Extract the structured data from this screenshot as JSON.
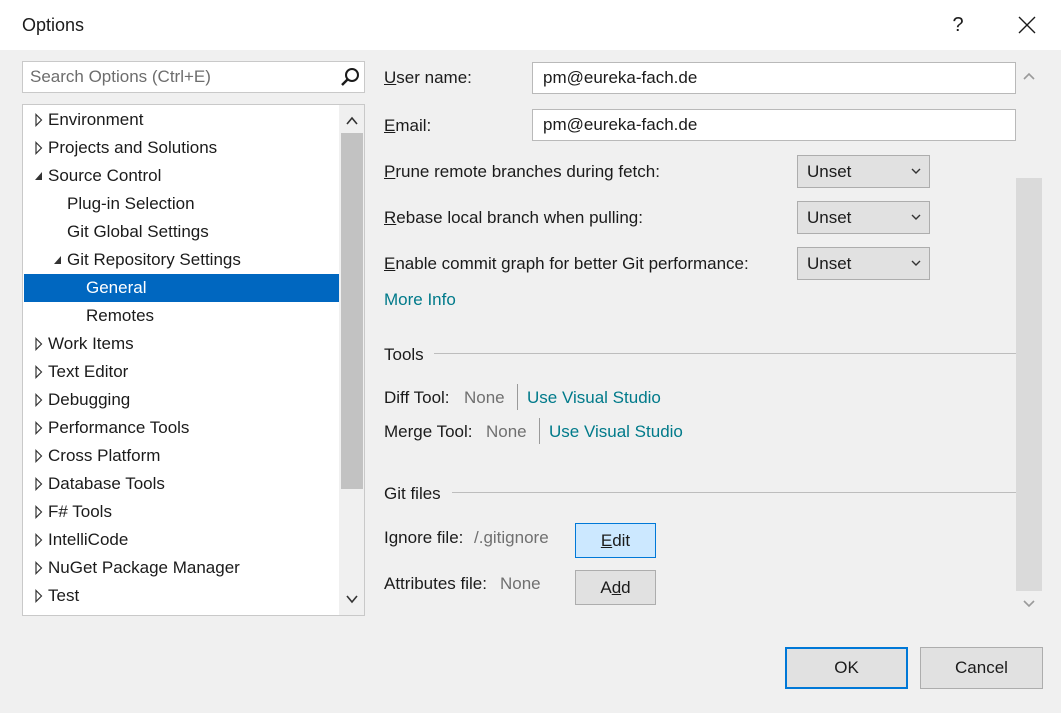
{
  "window": {
    "title": "Options",
    "help_label": "?"
  },
  "search": {
    "placeholder": "Search Options (Ctrl+E)"
  },
  "tree": {
    "items": [
      {
        "label": "Environment",
        "expander": "collapsed"
      },
      {
        "label": "Projects and Solutions",
        "expander": "collapsed"
      },
      {
        "label": "Source Control",
        "expander": "expanded"
      },
      {
        "label": "Plug-in Selection",
        "expander": "none"
      },
      {
        "label": "Git Global Settings",
        "expander": "none"
      },
      {
        "label": "Git Repository Settings",
        "expander": "expanded"
      },
      {
        "label": "General",
        "expander": "none",
        "selected": true
      },
      {
        "label": "Remotes",
        "expander": "none"
      },
      {
        "label": "Work Items",
        "expander": "collapsed"
      },
      {
        "label": "Text Editor",
        "expander": "collapsed"
      },
      {
        "label": "Debugging",
        "expander": "collapsed"
      },
      {
        "label": "Performance Tools",
        "expander": "collapsed"
      },
      {
        "label": "Cross Platform",
        "expander": "collapsed"
      },
      {
        "label": "Database Tools",
        "expander": "collapsed"
      },
      {
        "label": "F# Tools",
        "expander": "collapsed"
      },
      {
        "label": "IntelliCode",
        "expander": "collapsed"
      },
      {
        "label": "NuGet Package Manager",
        "expander": "collapsed"
      },
      {
        "label": "Test",
        "expander": "collapsed"
      }
    ]
  },
  "settings": {
    "user_name": {
      "access_key": "U",
      "rest": "ser name:",
      "value": "pm@eureka-fach.de"
    },
    "email": {
      "access_key": "E",
      "rest": "mail:",
      "value": "pm@eureka-fach.de"
    },
    "prune": {
      "access_key": "P",
      "rest": "rune remote branches during fetch:",
      "value": "Unset"
    },
    "rebase": {
      "access_key": "R",
      "rest": "ebase local branch when pulling:",
      "value": "Unset"
    },
    "commit_graph": {
      "access_key": "E",
      "rest": "nable commit graph for better Git performance:",
      "value": "Unset"
    },
    "more_info": "More Info"
  },
  "tools": {
    "heading": "Tools",
    "diff_label": "Diff Tool:",
    "diff_value": "None",
    "diff_link": "Use Visual Studio",
    "merge_label": "Merge Tool:",
    "merge_value": "None",
    "merge_link": "Use Visual Studio"
  },
  "git_files": {
    "heading": "Git files",
    "ignore_label": "Ignore file:",
    "ignore_value": "/.gitignore",
    "edit_key": "E",
    "edit_rest": "dit",
    "attributes_label": "Attributes file:",
    "attributes_value": "None",
    "add_first": "A",
    "add_key": "d",
    "add_rest": "d"
  },
  "footer": {
    "ok_label": "OK",
    "cancel_label": "Cancel"
  },
  "colors": {
    "selection": "#0067c0",
    "link": "#007a8a",
    "primary_border": "#0078d7",
    "hover_button": "#cce8ff"
  }
}
